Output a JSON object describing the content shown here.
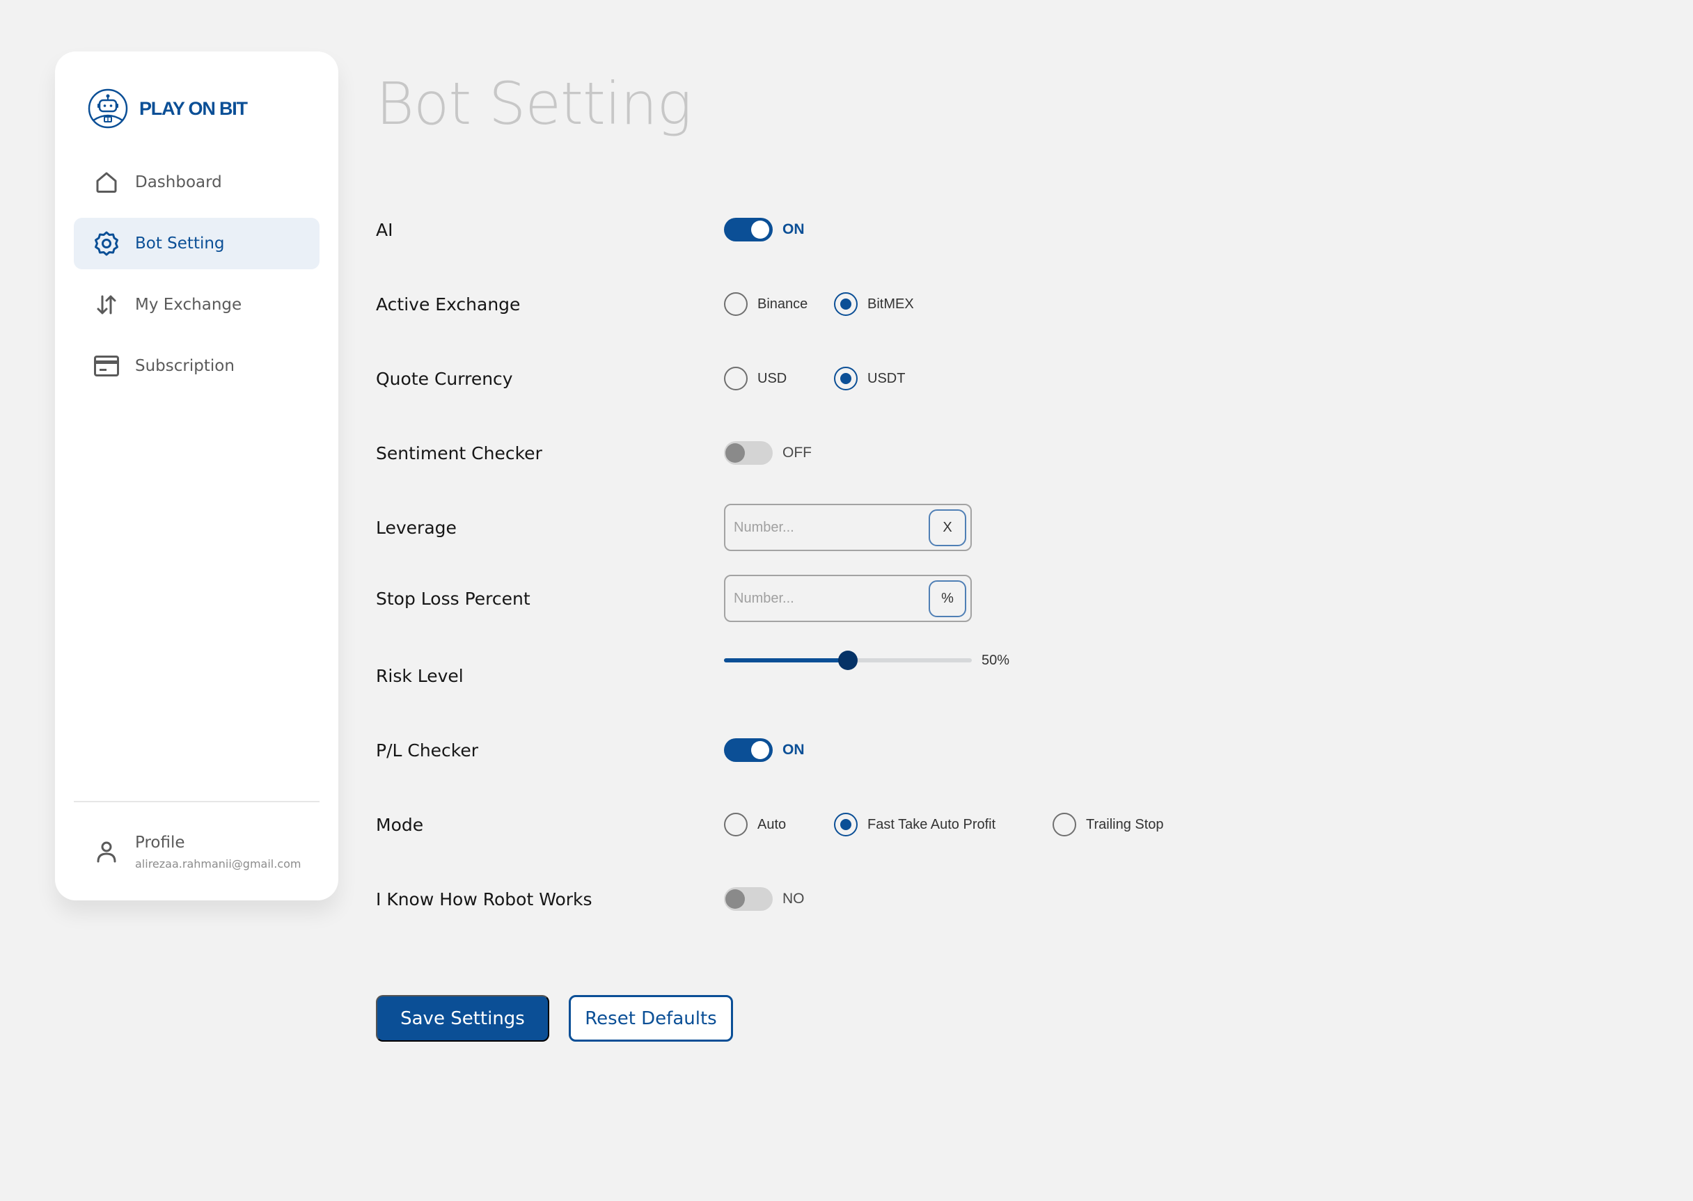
{
  "app": {
    "brand": "PLAY ON BIT",
    "accent": "#0b4f96"
  },
  "sidebar": {
    "items": [
      {
        "label": "Dashboard",
        "icon": "home-icon",
        "active": false
      },
      {
        "label": "Bot Setting",
        "icon": "gear-icon",
        "active": true
      },
      {
        "label": "My Exchange",
        "icon": "swap-vertical-icon",
        "active": false
      },
      {
        "label": "Subscription",
        "icon": "credit-card-icon",
        "active": false
      }
    ],
    "profile": {
      "name": "Profile",
      "email": "alirezaa.rahmanii@gmail.com"
    }
  },
  "page": {
    "title": "Bot Setting"
  },
  "settings": {
    "ai": {
      "label": "AI",
      "value": true,
      "state_text": "ON"
    },
    "active_exchange": {
      "label": "Active Exchange",
      "options": [
        "Binance",
        "BitMEX"
      ],
      "selected": "BitMEX"
    },
    "quote_currency": {
      "label": "Quote Currency",
      "options": [
        "USD",
        "USDT"
      ],
      "selected": "USDT"
    },
    "sentiment_checker": {
      "label": "Sentiment Checker",
      "value": false,
      "state_text": "OFF"
    },
    "leverage": {
      "label": "Leverage",
      "value": "",
      "placeholder": "Number...",
      "unit": "X"
    },
    "stop_loss": {
      "label": "Stop Loss Percent",
      "value": "",
      "placeholder": "Number...",
      "unit": "%"
    },
    "risk_level": {
      "label": "Risk Level",
      "value": 50,
      "value_text": "50%"
    },
    "pl_checker": {
      "label": "P/L Checker",
      "value": true,
      "state_text": "ON"
    },
    "mode": {
      "label": "Mode",
      "options": [
        "Auto",
        "Fast Take Auto Profit",
        "Trailing Stop"
      ],
      "selected": "Fast Take Auto Profit"
    },
    "robot_works": {
      "label": "I Know How Robot Works",
      "value": false,
      "state_text": "NO"
    }
  },
  "actions": {
    "save_label": "Save Settings",
    "reset_label": "Reset Defaults"
  }
}
